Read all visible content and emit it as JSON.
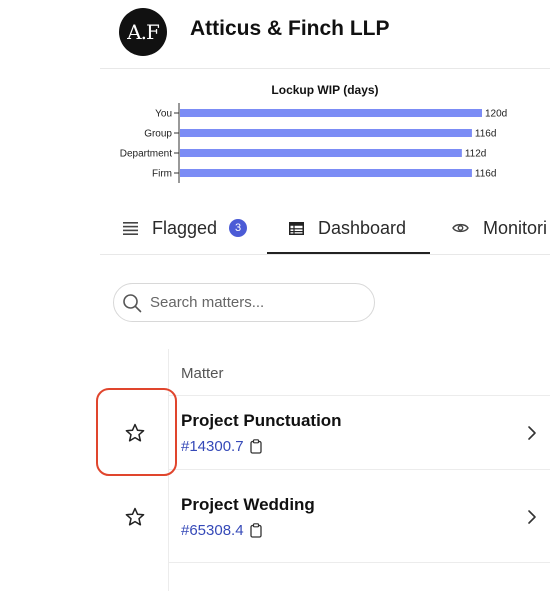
{
  "header": {
    "logo_text": "A.F",
    "firm_name": "Atticus & Finch LLP"
  },
  "chart_data": {
    "type": "bar",
    "orientation": "horizontal",
    "title": "Lockup WIP (days)",
    "categories": [
      "You",
      "Group",
      "Department",
      "Firm"
    ],
    "values": [
      120,
      116,
      112,
      116
    ],
    "value_labels": [
      "120d",
      "116d",
      "112d",
      "116d"
    ],
    "xlim": [
      0,
      120
    ],
    "bar_color": "#7b8cf5",
    "grid": false
  },
  "tabs": [
    {
      "label": "Flagged",
      "badge": "3",
      "icon": "list-icon"
    },
    {
      "label": "Dashboard",
      "icon": "table-icon",
      "active": true
    },
    {
      "label": "Monitori",
      "icon": "eye-icon"
    }
  ],
  "search": {
    "placeholder": "Search matters..."
  },
  "table": {
    "column_header": "Matter",
    "rows": [
      {
        "name": "Project Punctuation",
        "id": "#14300.7",
        "starred": false
      },
      {
        "name": "Project Wedding",
        "id": "#65308.4",
        "starred": false
      }
    ]
  },
  "colors": {
    "accent": "#4b5bd6",
    "link": "#3549b8",
    "highlight": "#e0452d"
  }
}
